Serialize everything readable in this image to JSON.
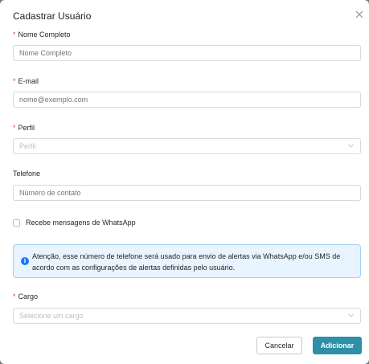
{
  "modal": {
    "title": "Cadastrar Usuário",
    "close_icon": "close-icon"
  },
  "fields": {
    "nome": {
      "required_mark": "*",
      "label": "Nome Completo",
      "placeholder": "Nome Completo",
      "value": ""
    },
    "email": {
      "required_mark": "*",
      "label": "E-mail",
      "placeholder": "nome@exemplo.com",
      "value": ""
    },
    "perfil": {
      "required_mark": "*",
      "label": "Perfil",
      "placeholder": "Perfil",
      "arrow_icon": "chevron-down-icon"
    },
    "telefone": {
      "label": "Telefone",
      "placeholder": "Número de contato",
      "value": ""
    },
    "whatsapp": {
      "label": "Recebe mensagens de WhatsApp",
      "checked": false
    },
    "cargo": {
      "required_mark": "*",
      "label": "Cargo",
      "placeholder": "Selecione um cargo",
      "arrow_icon": "chevron-down-icon"
    }
  },
  "alert": {
    "icon": "info-icon",
    "icon_glyph": "i",
    "text": "Atenção, esse número de telefone será usado para envio de alertas via WhatsApp e/ou SMS de acordo com as configurações de alertas definidas pelo usuário."
  },
  "buttons": {
    "cancel": "Cancelar",
    "add": "Adicionar"
  },
  "colors": {
    "primary": "#2d8fa8",
    "required": "#e0474b",
    "info": "#1677ff",
    "alert_bg": "#e8f4ff"
  }
}
